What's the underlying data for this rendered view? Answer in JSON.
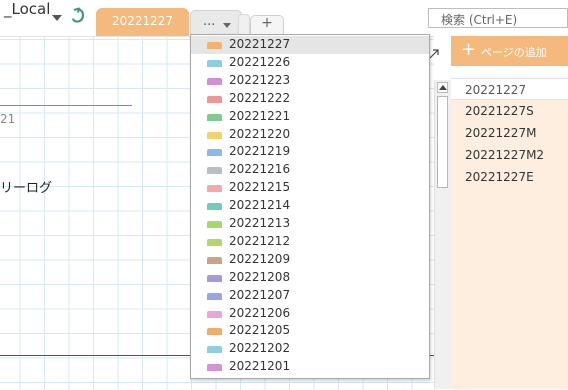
{
  "header": {
    "notebook_name": "_Local",
    "active_section": "20221227",
    "more_label": "...",
    "add_tab_label": "+",
    "search_placeholder": "検索 (Ctrl+E)"
  },
  "canvas": {
    "date_fragment": "21",
    "title_fragment": "リーログ"
  },
  "pages_panel": {
    "add_page_label": "ページの追加",
    "pages": [
      "20221227",
      "20221227S",
      "20221227M",
      "20221227M2",
      "20221227E"
    ],
    "active_index": 0
  },
  "dropdown": {
    "selected_index": 0,
    "items": [
      {
        "label": "20221227",
        "color": "#f4b26c"
      },
      {
        "label": "20221226",
        "color": "#8ccde6"
      },
      {
        "label": "20221223",
        "color": "#d38fd5"
      },
      {
        "label": "20221222",
        "color": "#f09595"
      },
      {
        "label": "20221221",
        "color": "#7fcc8e"
      },
      {
        "label": "20221220",
        "color": "#f2d36b"
      },
      {
        "label": "20221219",
        "color": "#8fb7e8"
      },
      {
        "label": "20221216",
        "color": "#b8bfc4"
      },
      {
        "label": "20221215",
        "color": "#f3a9a9"
      },
      {
        "label": "20221214",
        "color": "#6fcfb6"
      },
      {
        "label": "20221213",
        "color": "#a8d869"
      },
      {
        "label": "20221212",
        "color": "#b3d66a"
      },
      {
        "label": "20221209",
        "color": "#c9a383"
      },
      {
        "label": "20221208",
        "color": "#a99ad9"
      },
      {
        "label": "20221207",
        "color": "#94a9dd"
      },
      {
        "label": "20221206",
        "color": "#e8a6d6"
      },
      {
        "label": "20221205",
        "color": "#f2ac6a"
      },
      {
        "label": "20221202",
        "color": "#8fcde5"
      },
      {
        "label": "20221201",
        "color": "#d693d3"
      }
    ]
  },
  "colors": {
    "accent": "#f4b97c",
    "page_panel_bg": "#fdeee0",
    "sync_icon": "#3f9a77"
  },
  "icons": {
    "sync": "sync-icon",
    "expand": "expand-icon",
    "add_page": "plus-icon",
    "more_arrow": "chevron-down-icon"
  }
}
